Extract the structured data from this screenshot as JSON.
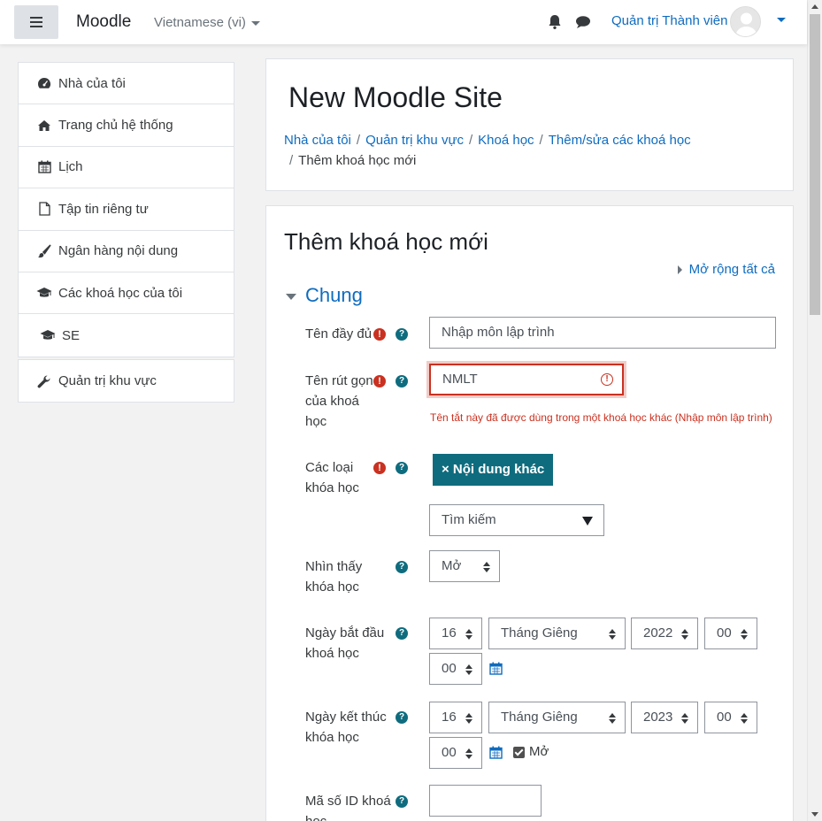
{
  "navbar": {
    "brand": "Moodle",
    "language": "Vietnamese (vi)",
    "username": "Quản trị Thành viên"
  },
  "drawer": {
    "items": [
      {
        "label": "Nhà của tôi",
        "icon": "dashboard-icon"
      },
      {
        "label": "Trang chủ hệ thống",
        "icon": "home-icon"
      },
      {
        "label": "Lịch",
        "icon": "calendar-icon"
      },
      {
        "label": "Tập tin riêng tư",
        "icon": "file-icon"
      },
      {
        "label": "Ngân hàng nội dung",
        "icon": "paintbrush-icon"
      },
      {
        "label": "Các khoá học của tôi",
        "icon": "graduation-cap-icon"
      },
      {
        "label": "SE",
        "icon": "graduation-cap-icon"
      }
    ],
    "admin": {
      "label": "Quản trị khu vực",
      "icon": "wrench-icon"
    }
  },
  "header": {
    "site_title": "New Moodle Site",
    "breadcrumb": [
      "Nhà của tôi",
      "Quản trị khu vực",
      "Khoá học",
      "Thêm/sửa các khoá học",
      "Thêm khoá học mới"
    ]
  },
  "form": {
    "title": "Thêm khoá học mới",
    "expand_all": "Mở rộng tất cả",
    "section": "Chung",
    "fullname": {
      "label": "Tên đầy đủ",
      "value": "Nhập môn lập trình"
    },
    "shortname": {
      "label": "Tên rút gọn của khoá học",
      "value": "NMLT",
      "error": "Tên tắt này đã được dùng trong một khoá học khác (Nhập môn lập trình)"
    },
    "category": {
      "label": "Các loại khóa học",
      "tag": "× Nội dung khác",
      "search_placeholder": "Tìm kiếm"
    },
    "visible": {
      "label": "Nhìn thấy khóa học",
      "value": "Mở"
    },
    "startdate": {
      "label": "Ngày bắt đầu khoá học",
      "day": "16",
      "month": "Tháng Giêng",
      "year": "2022",
      "hour": "00",
      "minute": "00"
    },
    "enddate": {
      "label": "Ngày kết thúc khóa học",
      "day": "16",
      "month": "Tháng Giêng",
      "year": "2023",
      "hour": "00",
      "minute": "00",
      "enable_label": "Mở"
    },
    "idnumber": {
      "label": "Mã số ID khoá học",
      "value": ""
    }
  },
  "colors": {
    "link": "#0f6cbf",
    "error": "#ca3120",
    "help": "#0f6c7e"
  }
}
